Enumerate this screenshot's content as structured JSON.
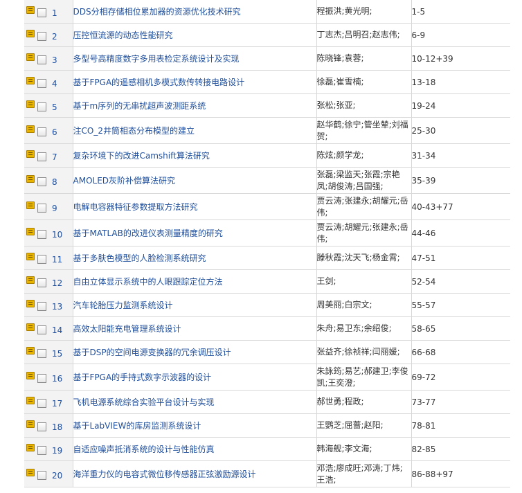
{
  "colors": {
    "link": "#1e4e9c",
    "text": "#333333",
    "row_shade": "#f3f3f3",
    "border": "#d8d8d8",
    "fav_icon": "#e8b400"
  },
  "icons": {
    "row_icon": "favorite-folder-icon",
    "row_checkbox": "checkbox-unchecked"
  },
  "articles": [
    {
      "no": "1",
      "title": "DDS分相存储相位累加器的资源优化技术研究",
      "authors": "程振洪;黄光明;",
      "pages": "1-5"
    },
    {
      "no": "2",
      "title": "压控恒流源的动态性能研究",
      "authors": "丁志杰;吕明召;赵志伟;",
      "pages": "6-9"
    },
    {
      "no": "3",
      "title": "多型号高精度数字多用表检定系统设计及实现",
      "authors": "陈晓锋;袁蓉;",
      "pages": "10-12+39"
    },
    {
      "no": "4",
      "title": "基于FPGA的遥感相机多模式数传转接电路设计",
      "authors": "徐磊;崔雪楠;",
      "pages": "13-18"
    },
    {
      "no": "5",
      "title": "基于m序列的无串扰超声波测距系统",
      "authors": "张松;张亚;",
      "pages": "19-24"
    },
    {
      "no": "6",
      "title": "注CO_2井筒相态分布模型的建立",
      "authors": "赵华鹤;徐宁;管坐辇;刘福贺;",
      "pages": "25-30"
    },
    {
      "no": "7",
      "title": "复杂环境下的改进Camshift算法研究",
      "authors": "陈炫;颜学龙;",
      "pages": "31-34"
    },
    {
      "no": "8",
      "title": "AMOLED灰阶补偿算法研究",
      "authors": "张磊;梁监天;张霞;宗艳凤;胡俊涛;吕国强;",
      "pages": "35-39"
    },
    {
      "no": "9",
      "title": "电解电容器特征参数提取方法研究",
      "authors": "贾云涛;张建永;胡耀元;岳伟;",
      "pages": "40-43+77"
    },
    {
      "no": "10",
      "title": "基于MATLAB的改进仪表测量精度的研究",
      "authors": "贾云涛;胡耀元;张建永;岳伟;",
      "pages": "44-46"
    },
    {
      "no": "11",
      "title": "基于多肤色模型的人脸检测系统研究",
      "authors": "滕秋霞;沈天飞;杨金霄;",
      "pages": "47-51"
    },
    {
      "no": "12",
      "title": "自由立体显示系统中的人眼跟踪定位方法",
      "authors": "王剑;",
      "pages": "52-54"
    },
    {
      "no": "13",
      "title": "汽车轮胎压力监测系统设计",
      "authors": "周美丽;白宗文;",
      "pages": "55-57"
    },
    {
      "no": "14",
      "title": "高效太阳能充电管理系统设计",
      "authors": "朱舟;易卫东;余绍俊;",
      "pages": "58-65"
    },
    {
      "no": "15",
      "title": "基于DSP的空间电源变换器的冗余调压设计",
      "authors": "张益齐;徐祯祥;闫丽媛;",
      "pages": "66-68"
    },
    {
      "no": "16",
      "title": "基于FPGA的手持式数字示波器的设计",
      "authors": "朱詠筠;易艺;郝建卫;李俊凯;王奕澄;",
      "pages": "69-72"
    },
    {
      "no": "17",
      "title": "飞机电源系统综合实验平台设计与实现",
      "authors": "郝世勇;程政;",
      "pages": "73-77"
    },
    {
      "no": "18",
      "title": "基于LabVIEW的库房监测系统设计",
      "authors": "王鹦芝;屈蔷;赵阳;",
      "pages": "78-81"
    },
    {
      "no": "19",
      "title": "自适应噪声抵消系统的设计与性能仿真",
      "authors": "韩海舰;李文海;",
      "pages": "82-85"
    },
    {
      "no": "20",
      "title": "海洋重力仪的电容式微位移传感器正弦激励源设计",
      "authors": "邓浩;廖成旺;邓涛;丁炜;王浩;",
      "pages": "86-88+97"
    }
  ]
}
